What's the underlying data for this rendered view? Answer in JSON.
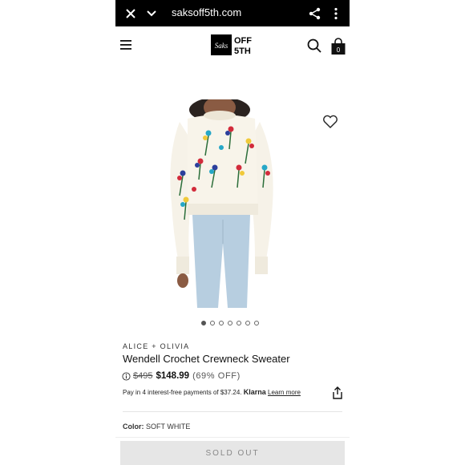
{
  "browser": {
    "url": "saksoff5th.com"
  },
  "header": {
    "logo_script": "Saks",
    "logo_line1": "OFF",
    "logo_line2": "5TH",
    "cart_count": "0"
  },
  "gallery": {
    "slide_count": 7,
    "active_slide": 1
  },
  "product": {
    "brand": "ALICE + OLIVIA",
    "name": "Wendell Crochet Crewneck Sweater",
    "original_price": "$495",
    "sale_price": "$148.99",
    "discount": "(69% OFF)",
    "klarna_text": "Pay in 4 interest-free payments of $37.24.",
    "klarna_brand": "Klarna",
    "klarna_link": "Learn more",
    "color_label": "Color:",
    "color_value": "SOFT WHITE",
    "cta_label": "SOLD OUT"
  },
  "colors": {
    "url_bar": "#000000",
    "button_bg": "#e6e6e6",
    "button_text": "#888888"
  }
}
